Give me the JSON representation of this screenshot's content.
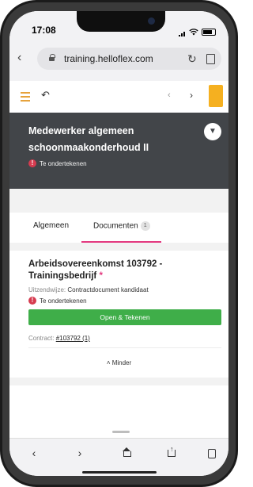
{
  "status_bar": {
    "time": "17:08"
  },
  "browser": {
    "url": "training.helloflex.com"
  },
  "header": {
    "title": "Medewerker algemeen schoonmaakonderhoud II",
    "status": "Te ondertekenen"
  },
  "tabs": [
    {
      "label": "Algemeen"
    },
    {
      "label": "Documenten",
      "badge": "1"
    }
  ],
  "document": {
    "title": "Arbeidsovereenkomst 103792 - Trainingsbedrijf",
    "required_mark": "*",
    "meta_label": "Uitzendwijze:",
    "meta_value": "Contractdocument kandidaat",
    "status": "Te ondertekenen",
    "action": "Open & Tekenen",
    "contract_label": "Contract:",
    "contract_link": "#103792 (1)",
    "less": "Minder"
  },
  "colors": {
    "accent": "#e3397f",
    "header_bg": "#424549",
    "button_green": "#3fae49",
    "menu_orange": "#e6a23c"
  }
}
